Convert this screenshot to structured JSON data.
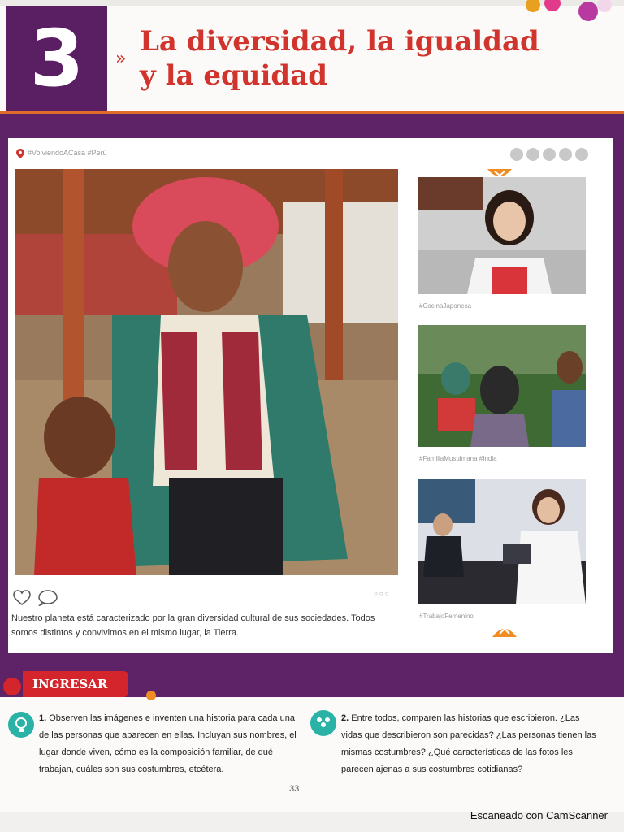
{
  "chapter": {
    "number": "3",
    "arrows": "»",
    "title": "La diversidad, la igualdad\ny la equidad"
  },
  "post": {
    "hashtags": "#VolviendoACasa #Perú",
    "caption": "Nuestro planeta está caracterizado por la gran diversidad cultural de sus sociedades. Todos somos distintos y convivimos en el mismo lugar, la Tierra.",
    "dots": "○○○"
  },
  "side_posts": [
    {
      "tag": "#CocinaJaponesa"
    },
    {
      "tag": "#FamiliaMusulmana #India"
    },
    {
      "tag": "#TrabajoFemenino"
    }
  ],
  "section": {
    "label": "INGRESAR"
  },
  "activities": [
    {
      "number": "1.",
      "text": "Observen las imágenes e inventen una historia para cada una de las personas que aparecen en ellas. Incluyan sus nombres, el lugar donde viven, cómo es la composición familiar, de qué trabajan, cuáles son sus costumbres, etcétera."
    },
    {
      "number": "2.",
      "text": "Entre todos, comparen las historias que escribieron. ¿Las vidas que describieron son parecidas? ¿Las personas tienen las mismas costumbres? ¿Qué características de las fotos les parecen ajenas a sus costumbres cotidianas?"
    }
  ],
  "page_number": "33",
  "footer": "Escaneado con CamScanner",
  "colors": {
    "purple": "#5e2366",
    "red": "#d0342c",
    "orange": "#f08c24",
    "teal": "#2bb2a6"
  }
}
